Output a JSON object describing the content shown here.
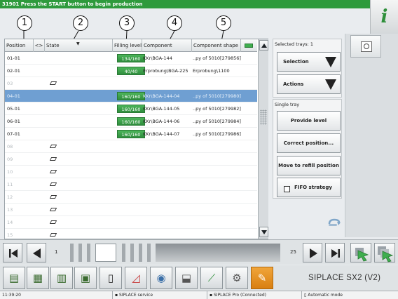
{
  "topbar": {
    "message": "31901 Press the START button to begin production",
    "help_label": "i"
  },
  "callouts": [
    "1",
    "2",
    "3",
    "4",
    "5"
  ],
  "table": {
    "headers": {
      "position": "Position",
      "state": "State",
      "filling_level": "Filling level",
      "component": "Component",
      "component_shape": "Component shape"
    },
    "rows": [
      {
        "position": "01-01",
        "filling": "134/160",
        "component": "KKr\\BGA-144",
        "shape": "..py of 5010[279856]",
        "has_tray": false,
        "selected": false,
        "dim": false
      },
      {
        "position": "02-01",
        "filling": "40/40",
        "component": "Erprobung\\BGA-225",
        "shape": "Erprobung\\1100",
        "has_tray": false,
        "selected": false,
        "dim": false
      },
      {
        "position": "03",
        "filling": "",
        "component": "",
        "shape": "",
        "has_tray": true,
        "selected": false,
        "dim": true
      },
      {
        "position": "04-01",
        "filling": "160/160",
        "component": "KKr\\BGA-144-04",
        "shape": "..py of 5010[279980]",
        "has_tray": false,
        "selected": true,
        "dim": false
      },
      {
        "position": "05-01",
        "filling": "160/160",
        "component": "KKr\\BGA-144-05",
        "shape": "..py of 5010[279982]",
        "has_tray": false,
        "selected": false,
        "dim": false
      },
      {
        "position": "06-01",
        "filling": "160/160",
        "component": "KKr\\BGA-144-06",
        "shape": "..py of 5010[279984]",
        "has_tray": false,
        "selected": false,
        "dim": false
      },
      {
        "position": "07-01",
        "filling": "160/160",
        "component": "KKr\\BGA-144-07",
        "shape": "..py of 5010[279986]",
        "has_tray": false,
        "selected": false,
        "dim": false
      },
      {
        "position": "08",
        "filling": "",
        "component": "",
        "shape": "",
        "has_tray": true,
        "selected": false,
        "dim": true
      },
      {
        "position": "09",
        "filling": "",
        "component": "",
        "shape": "",
        "has_tray": true,
        "selected": false,
        "dim": true
      },
      {
        "position": "10",
        "filling": "",
        "component": "",
        "shape": "",
        "has_tray": true,
        "selected": false,
        "dim": true
      },
      {
        "position": "11",
        "filling": "",
        "component": "",
        "shape": "",
        "has_tray": true,
        "selected": false,
        "dim": true
      },
      {
        "position": "12",
        "filling": "",
        "component": "",
        "shape": "",
        "has_tray": true,
        "selected": false,
        "dim": true
      },
      {
        "position": "13",
        "filling": "",
        "component": "",
        "shape": "",
        "has_tray": true,
        "selected": false,
        "dim": true
      },
      {
        "position": "14",
        "filling": "",
        "component": "",
        "shape": "",
        "has_tray": true,
        "selected": false,
        "dim": true
      },
      {
        "position": "15",
        "filling": "",
        "component": "",
        "shape": "",
        "has_tray": true,
        "selected": false,
        "dim": true
      }
    ]
  },
  "right_panel": {
    "selected_trays": "Selected trays: 1",
    "selection": "Selection",
    "actions": "Actions",
    "single_tray": "Single tray",
    "provide_level": "Provide level",
    "correct_position": "Correct position...",
    "move_to_refill": "Move to refill position",
    "fifo": "FIFO strategy"
  },
  "pager": {
    "first": "1",
    "last": "25"
  },
  "brand": "SIPLACE SX2 (V2)",
  "status": {
    "time": "11:39:20",
    "service": "SIPLACE service",
    "pro": "SIPLACE Pro (Connected)",
    "mode": "Automatic mode"
  },
  "colors": {
    "accent_green": "#2e9a3c",
    "selection_blue": "#6f9fd2",
    "active_tool_orange": "#e08a1c"
  }
}
